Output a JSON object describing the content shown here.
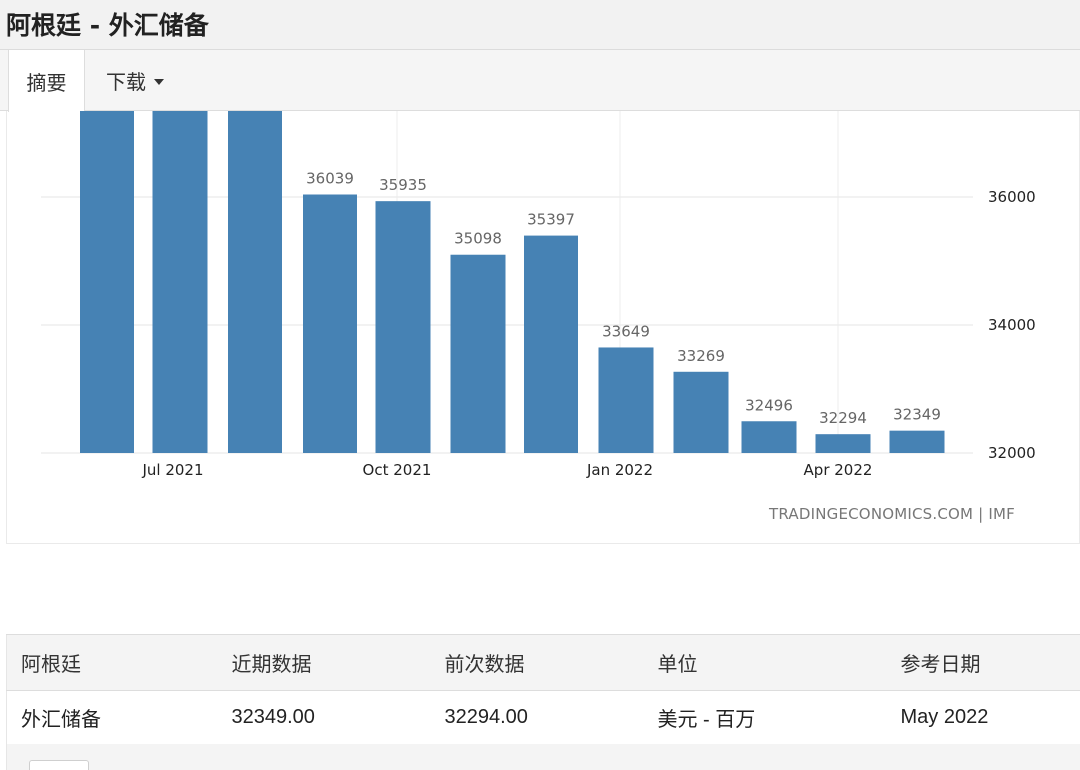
{
  "page": {
    "title": "阿根廷 - 外汇储备"
  },
  "tabs": [
    {
      "label": "摘要"
    },
    {
      "label": "下载"
    }
  ],
  "chart_data": {
    "type": "bar",
    "categories": [
      "2021-05",
      "2021-06",
      "2021-07",
      "2021-08",
      "2021-09",
      "2021-10",
      "2021-11",
      "2021-12",
      "2022-01",
      "2022-02",
      "2022-03",
      "2022-04",
      "2022-05"
    ],
    "values": [
      null,
      null,
      null,
      36039,
      35935,
      35098,
      35397,
      33649,
      33269,
      32496,
      32294,
      32349,
      null
    ],
    "value_labels": [
      "",
      "",
      "",
      "36039",
      "35935",
      "35098",
      "35397",
      "33649",
      "33269",
      "32496",
      "32294",
      "32349"
    ],
    "x_ticks": [
      "Jul 2021",
      "Oct 2021",
      "Jan 2022",
      "Apr 2022"
    ],
    "y_ticks": [
      "32000",
      "34000",
      "36000"
    ],
    "ylim": [
      32000,
      37330
    ],
    "grid": true,
    "y_axis_side": "right",
    "bar_color": "#4682b4",
    "source": "TRADINGECONOMICS.COM | IMF"
  },
  "table": {
    "headers": [
      "阿根廷",
      "近期数据",
      "前次数据",
      "单位",
      "参考日期"
    ],
    "rows": [
      [
        "外汇储备",
        "32349.00",
        "32294.00",
        "美元 - 百万",
        "May 2022"
      ]
    ]
  }
}
